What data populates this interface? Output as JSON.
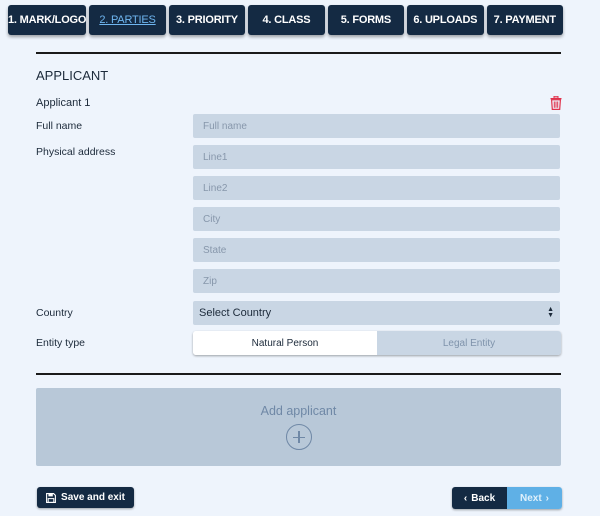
{
  "tabs": [
    {
      "label": "1. MARK/LOGO",
      "active": false
    },
    {
      "label": "2. PARTIES",
      "active": true
    },
    {
      "label": "3. PRIORITY",
      "active": false
    },
    {
      "label": "4. CLASS",
      "active": false
    },
    {
      "label": "5. FORMS",
      "active": false
    },
    {
      "label": "6. UPLOADS",
      "active": false
    },
    {
      "label": "7. PAYMENT",
      "active": false
    }
  ],
  "section": {
    "title": "APPLICANT",
    "applicant_label": "Applicant 1",
    "delete_icon": "trash-icon"
  },
  "form": {
    "full_name_label": "Full name",
    "full_name_placeholder": "Full name",
    "address_label": "Physical address",
    "line1_placeholder": "Line1",
    "line2_placeholder": "Line2",
    "city_placeholder": "City",
    "state_placeholder": "State",
    "zip_placeholder": "Zip",
    "country_label": "Country",
    "country_value": "Select Country",
    "entity_label": "Entity type",
    "entity_options": [
      "Natural Person",
      "Legal Entity"
    ],
    "entity_selected": "Natural Person"
  },
  "add_applicant": {
    "label": "Add applicant",
    "icon": "plus-circle-icon"
  },
  "footer": {
    "save_label": "Save and exit",
    "back_label": "Back",
    "next_label": "Next"
  },
  "colors": {
    "navy": "#142a43",
    "accent": "#5fb0e6",
    "danger": "#e0324b",
    "field_bg": "#c9d6e4",
    "page_bg": "#eef4fc"
  }
}
